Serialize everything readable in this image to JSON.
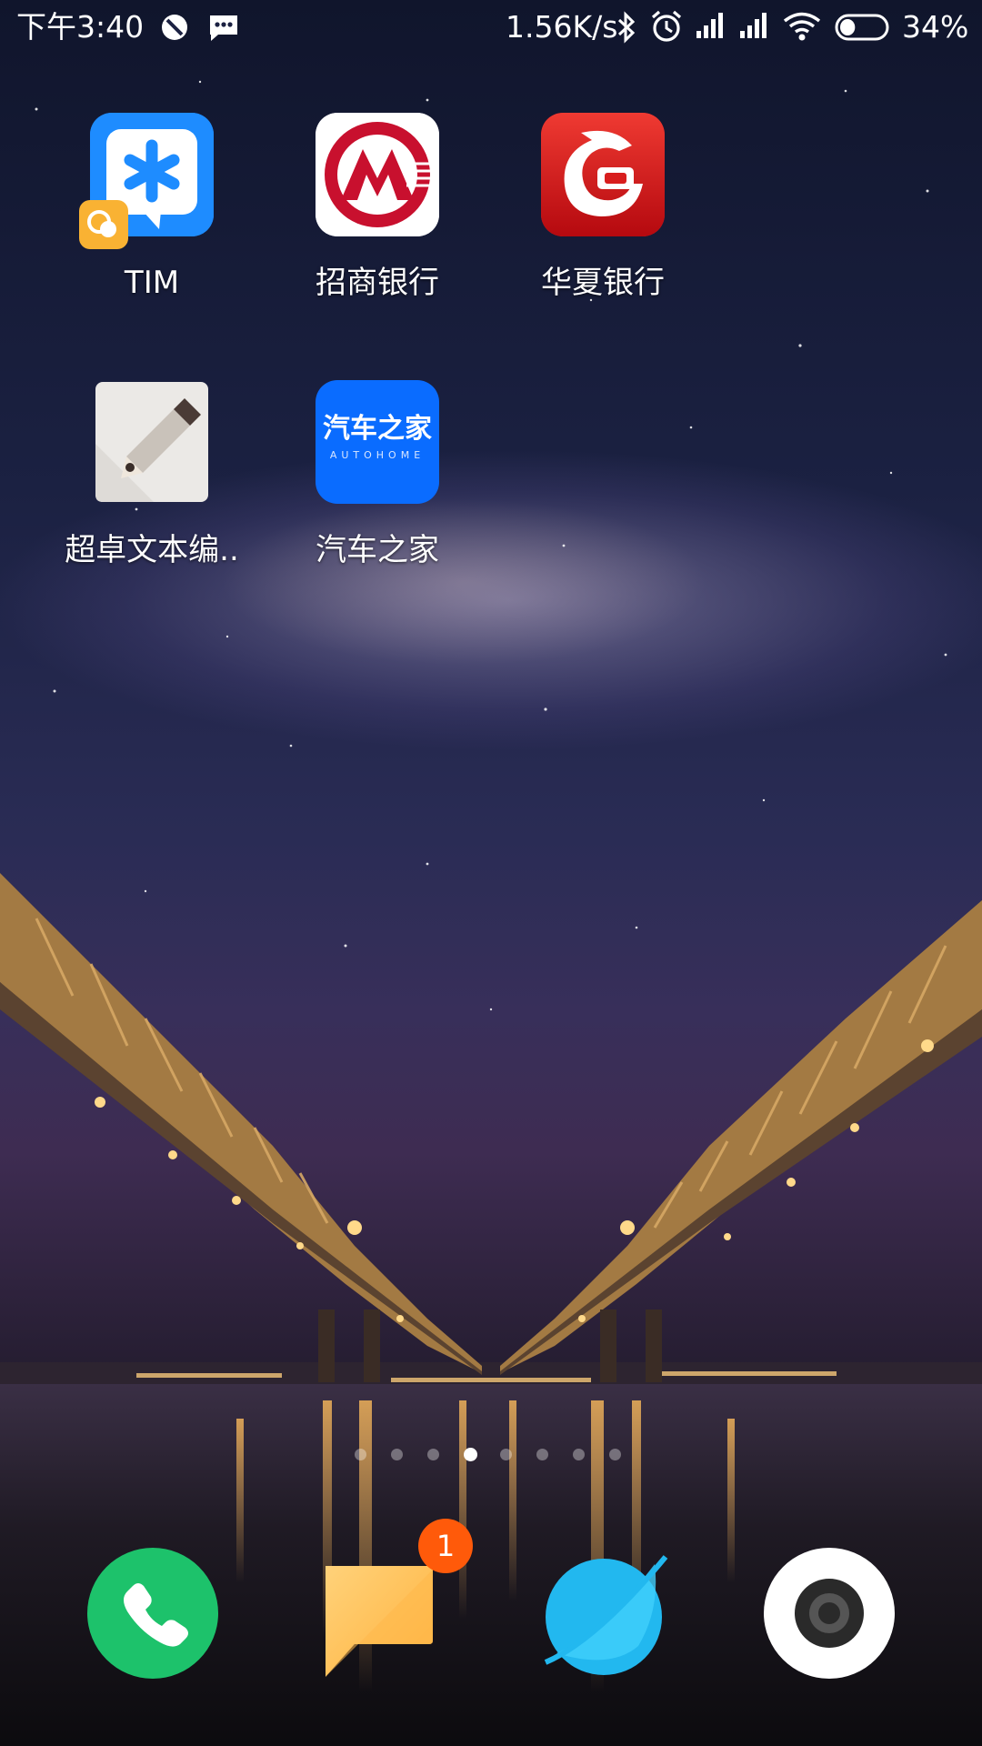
{
  "status_bar": {
    "time": "下午3:40",
    "network_speed": "1.56K/s",
    "battery_percent": "34%",
    "battery_level": 0.34,
    "icons": [
      "do-not-disturb-icon",
      "message-icon",
      "bluetooth-icon",
      "alarm-icon",
      "signal-icon",
      "signal-icon",
      "wifi-icon",
      "battery-icon"
    ]
  },
  "home_apps": [
    {
      "name": "TIM",
      "icon": "tim-icon",
      "color": "#1e8cff"
    },
    {
      "name": "招商银行",
      "icon": "cmb-icon",
      "color": "#c8102e"
    },
    {
      "name": "华夏银行",
      "icon": "hxb-icon",
      "color": "#d81e1e"
    },
    {
      "name": "超卓文本编..",
      "icon": "text-editor-icon",
      "color": "#e6e6e6"
    },
    {
      "name": "汽车之家",
      "icon": "autohome-icon",
      "color": "#0a6cff",
      "icon_text": "汽车之家",
      "icon_subtext": "AUTOHOME"
    }
  ],
  "page_indicator": {
    "count": 8,
    "active_index": 3
  },
  "dock": [
    {
      "icon": "phone-icon",
      "color": "#1dc26b"
    },
    {
      "icon": "messages-icon",
      "color": "#ffc15a",
      "badge": "1"
    },
    {
      "icon": "browser-icon",
      "color": "#2ec7f5"
    },
    {
      "icon": "camera-icon",
      "color": "#ffffff"
    }
  ]
}
